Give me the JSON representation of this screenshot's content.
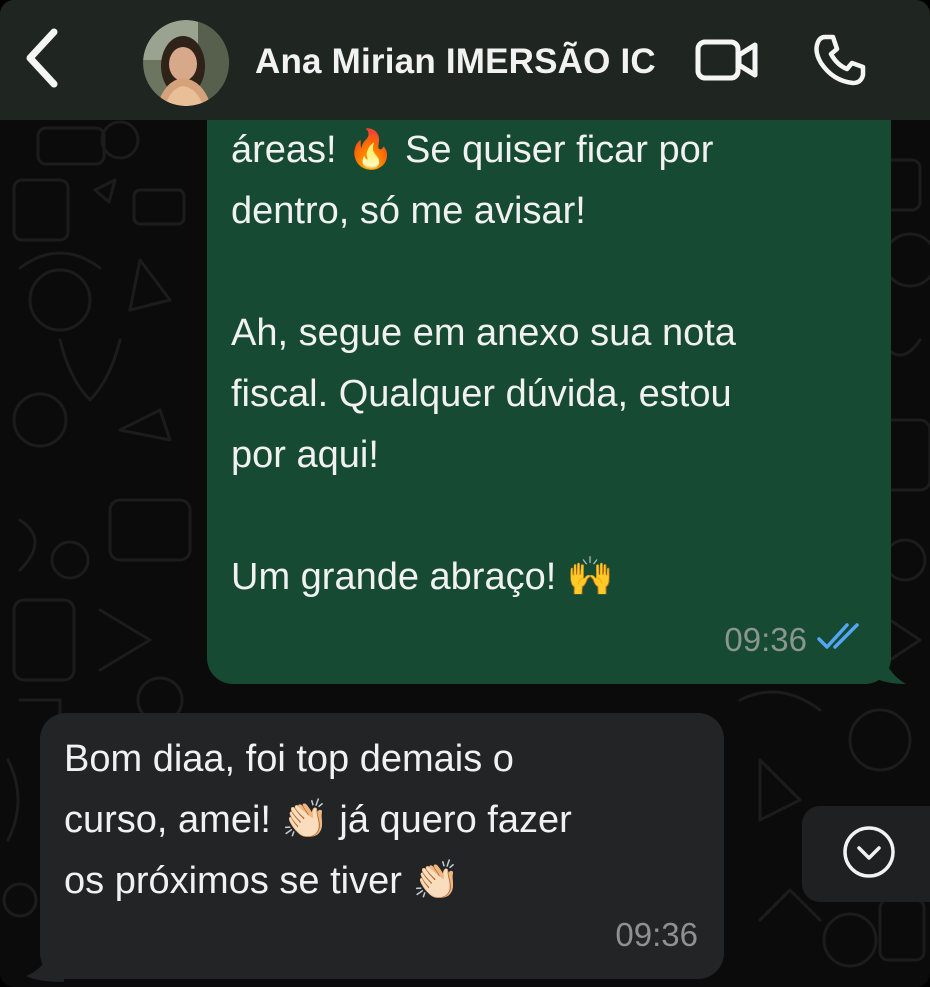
{
  "header": {
    "contact_name": "Ana Mirian IMERSÃO IC",
    "back_icon": "chevron-left-icon",
    "video_icon": "video-camera-icon",
    "call_icon": "phone-icon"
  },
  "messages": {
    "outgoing": {
      "lines": [
        "áreas! 🔥 Se quiser ficar por",
        "dentro, só me avisar!",
        "Ah, segue em anexo sua nota",
        "fiscal. Qualquer dúvida, estou",
        "por aqui!",
        "Um grande abraço! 🙌"
      ],
      "time": "09:36",
      "status": "read"
    },
    "incoming": {
      "lines": [
        "Bom diaa, foi top demais o",
        "curso, amei! 👏🏻 já quero fazer",
        "os próximos se tiver 👏🏻"
      ],
      "time": "09:36"
    }
  },
  "scroll_button": {
    "icon": "chevron-down-circle-icon"
  },
  "colors": {
    "header_bg": "#1f2622",
    "outgoing_bubble": "#164a32",
    "incoming_bubble": "#232426",
    "read_ticks": "#53a6f5",
    "chat_bg": "#0b0b0b"
  }
}
